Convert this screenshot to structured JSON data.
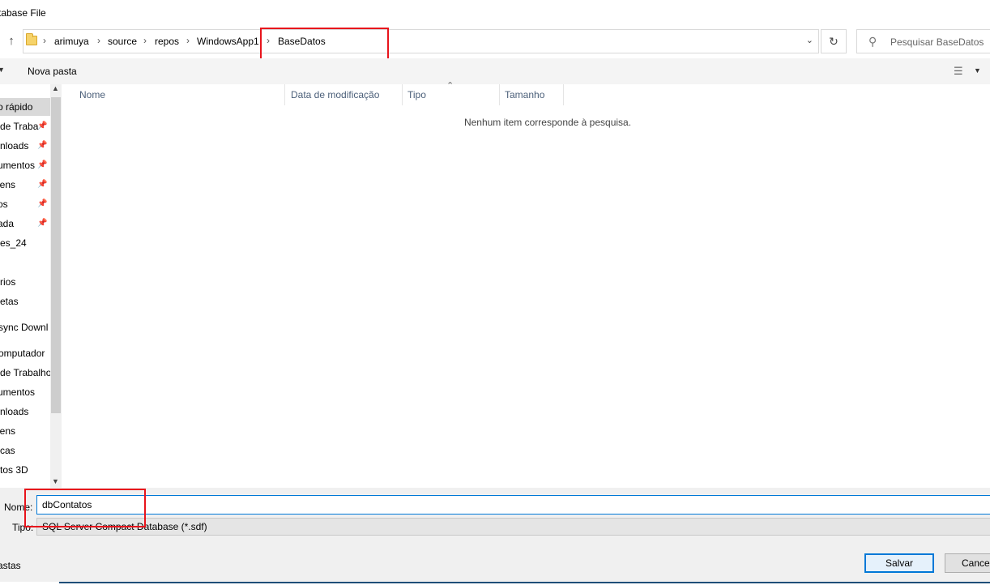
{
  "window": {
    "title": "tabase File"
  },
  "address": {
    "crumbs": [
      "arimuya",
      "source",
      "repos",
      "WindowsApp1",
      "BaseDatos"
    ]
  },
  "search": {
    "placeholder": "Pesquisar BaseDatos"
  },
  "toolbar": {
    "new_folder": "Nova pasta"
  },
  "nav": {
    "items": [
      {
        "label": "o rápido",
        "pinned": false,
        "selected": true
      },
      {
        "label": "de Traba",
        "pinned": true
      },
      {
        "label": "nloads",
        "pinned": true
      },
      {
        "label": "umentos",
        "pinned": true
      },
      {
        "label": "jens",
        "pinned": true
      },
      {
        "label": "os",
        "pinned": true
      },
      {
        "label": "ada",
        "pinned": true
      },
      {
        "label": "es_24",
        "pinned": false
      },
      {
        "label": "rios",
        "pinned": false
      },
      {
        "label": "etas",
        "pinned": false
      },
      {
        "label": "sync Downl",
        "pinned": false
      },
      {
        "label": "omputador",
        "pinned": false
      },
      {
        "label": "de Trabalho",
        "pinned": false
      },
      {
        "label": "umentos",
        "pinned": false
      },
      {
        "label": "nloads",
        "pinned": false
      },
      {
        "label": "jens",
        "pinned": false
      },
      {
        "label": "cas",
        "pinned": false
      },
      {
        "label": "tos 3D",
        "pinned": false
      }
    ]
  },
  "columns": [
    "Nome",
    "Data de modificação",
    "Tipo",
    "Tamanho"
  ],
  "empty_message": "Nenhum item corresponde à pesquisa.",
  "form": {
    "name_label": "Nome:",
    "name_value": "dbContatos",
    "type_label": "Tipo:",
    "type_value": "SQL Server Compact Database (*.sdf)"
  },
  "footer": {
    "hide_folders": "astas",
    "save_label": "Salvar",
    "cancel_label": "Cancel"
  },
  "colors": {
    "highlight": "#e8141c",
    "accent": "#0078d7"
  }
}
